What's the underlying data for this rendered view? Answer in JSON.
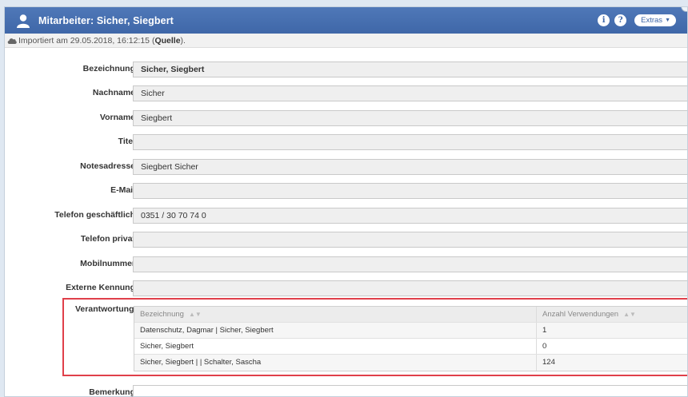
{
  "window": {
    "title": "Mitarbeiter: Sicher, Siegbert",
    "info_symbol": "i",
    "help_symbol": "?",
    "extras_label": "Extras",
    "extras_caret": "▼",
    "user_icon": "user-icon",
    "title_color": "#3f67a8"
  },
  "import": {
    "text_prefix": "Importiert am 29.05.2018, 16:12:15 (",
    "source_link": "Quelle",
    "text_suffix": ")."
  },
  "fields": {
    "bezeichnung": {
      "label": "Bezeichnung",
      "value": "Sicher, Siegbert"
    },
    "nachname": {
      "label": "Nachname",
      "value": "Sicher"
    },
    "vorname": {
      "label": "Vorname",
      "value": "Siegbert"
    },
    "titel": {
      "label": "Titel",
      "value": ""
    },
    "notesadresse": {
      "label": "Notesadresse",
      "value": "Siegbert Sicher"
    },
    "email": {
      "label": "E-Mail",
      "value": ""
    },
    "telefon_geschaeftlich": {
      "label": "Telefon geschäftlich",
      "value": "0351 / 30 70 74 0"
    },
    "telefon_privat": {
      "label": "Telefon privat",
      "value": ""
    },
    "mobilnummer": {
      "label": "Mobilnummer",
      "value": ""
    },
    "externe_kennung": {
      "label": "Externe Kennung",
      "value": ""
    },
    "bemerkung": {
      "label": "Bemerkung",
      "value": ""
    }
  },
  "verantwortung": {
    "label": "Verantwortung",
    "highlight_color": "#e0404a",
    "columns": [
      "Bezeichnung",
      "Anzahl Verwendungen"
    ],
    "sort_indicator": "▲▼",
    "rows": [
      {
        "bezeichnung": "Datenschutz, Dagmar | Sicher, Siegbert",
        "anzahl": "1"
      },
      {
        "bezeichnung": "Sicher, Siegbert",
        "anzahl": "0"
      },
      {
        "bezeichnung": "Sicher, Siegbert | | Schalter, Sascha",
        "anzahl": "124"
      }
    ]
  }
}
